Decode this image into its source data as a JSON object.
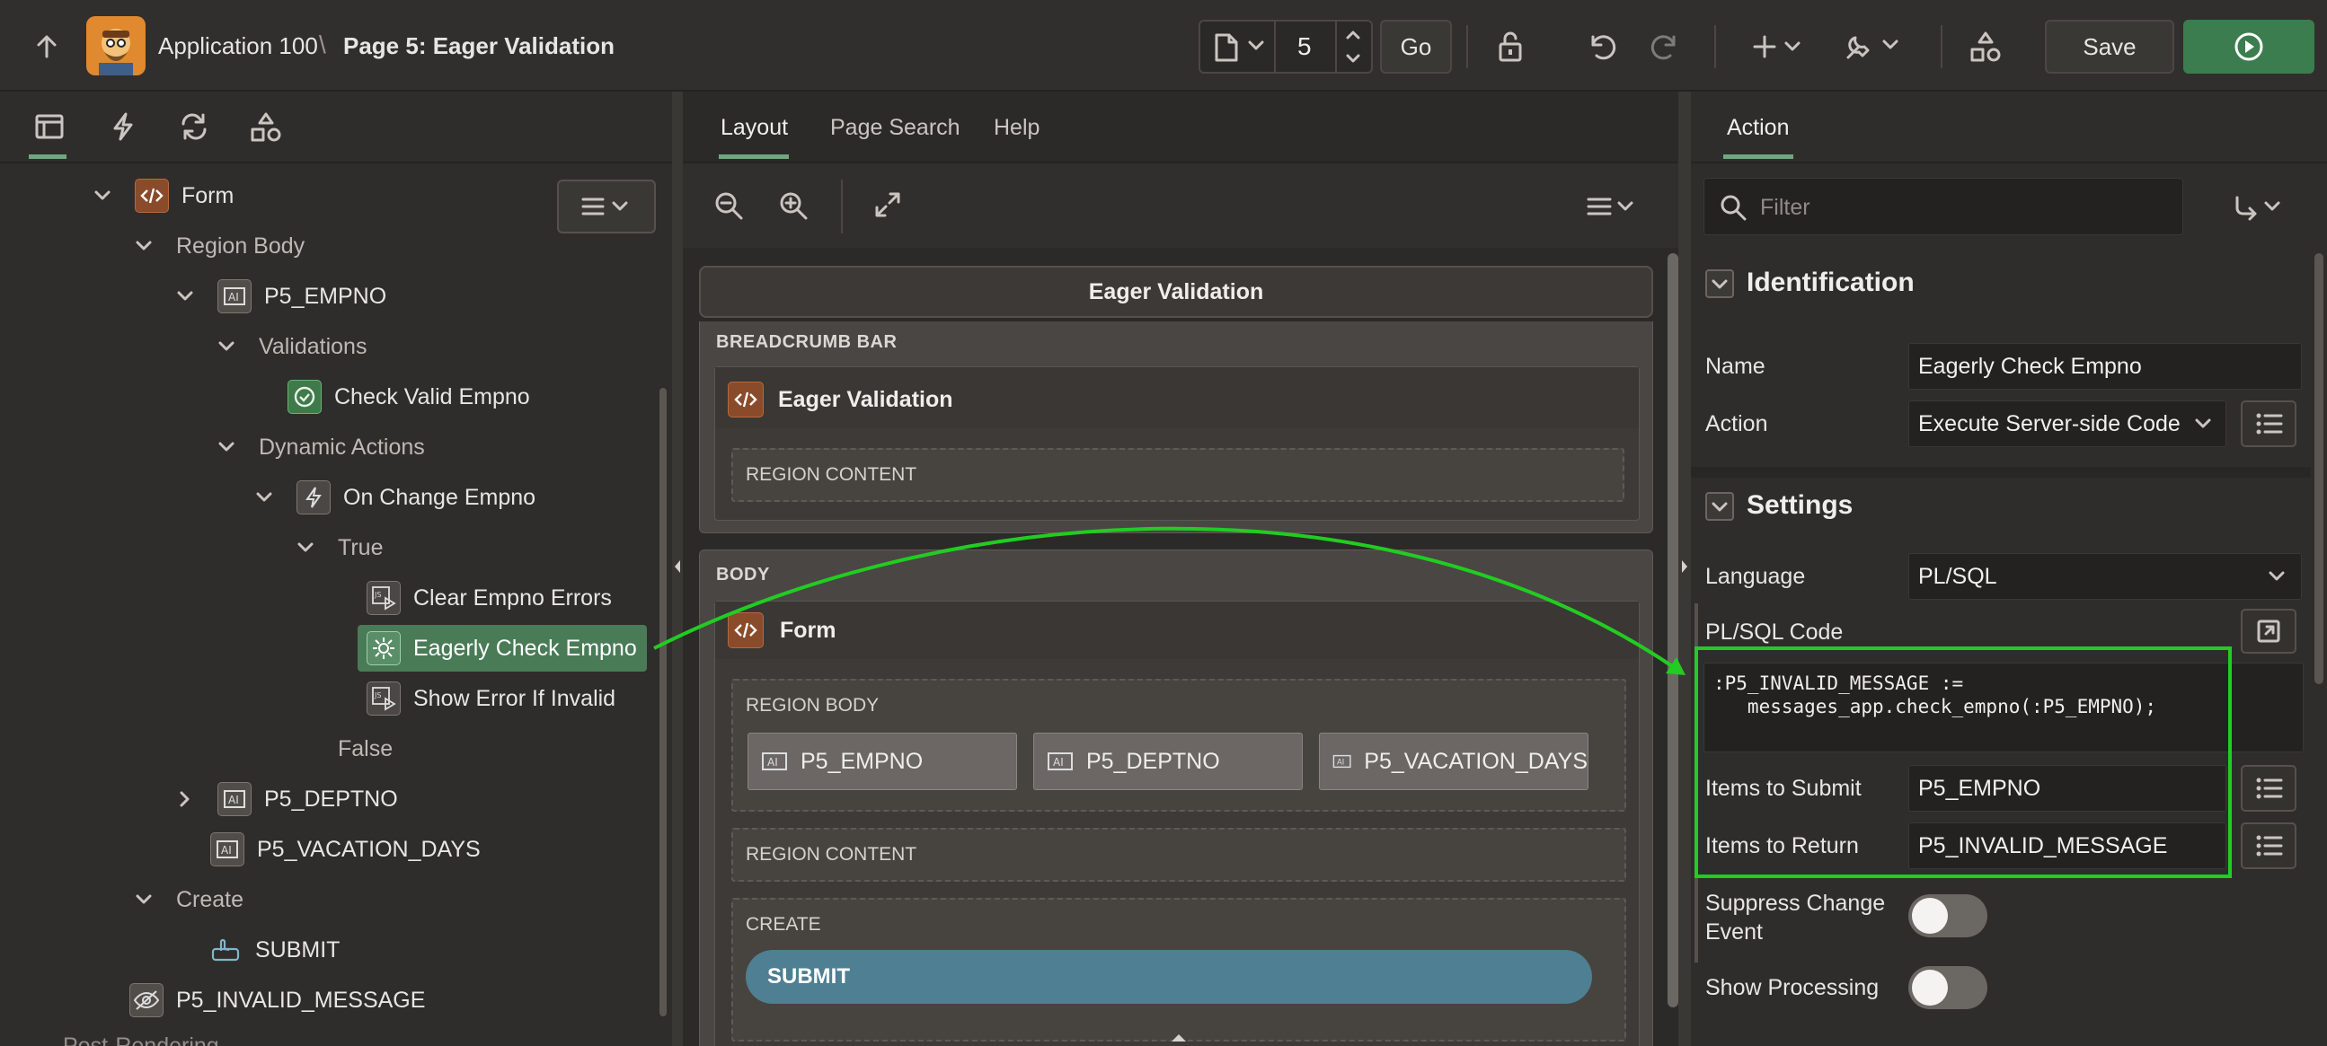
{
  "topbar": {
    "app_name": "Application 100",
    "separator": "\\",
    "page_title": "Page 5: Eager Validation",
    "page_number": "5",
    "go_label": "Go",
    "save_label": "Save"
  },
  "left_tabs": [
    "rendering-icon",
    "dynamic-actions-icon",
    "processing-icon",
    "shared-components-icon"
  ],
  "tree": {
    "form": "Form",
    "region_body": "Region Body",
    "p5_empno": "P5_EMPNO",
    "validations": "Validations",
    "check_valid_empno": "Check Valid Empno",
    "dynamic_actions": "Dynamic Actions",
    "on_change_empno": "On Change Empno",
    "true": "True",
    "clear_empno_errors": "Clear Empno Errors",
    "eagerly_check_empno": "Eagerly Check Empno",
    "show_error_if_invalid": "Show Error If Invalid",
    "false": "False",
    "p5_deptno": "P5_DEPTNO",
    "p5_vacation_days": "P5_VACATION_DAYS",
    "create": "Create",
    "submit": "SUBMIT",
    "p5_invalid_message": "P5_INVALID_MESSAGE",
    "post_rendering": "Post-Rendering"
  },
  "middle": {
    "tabs": [
      "Layout",
      "Page Search",
      "Help"
    ],
    "page_header": "Eager Validation",
    "breadcrumb_bar": "BREADCRUMB BAR",
    "breadcrumb_region": "Eager Validation",
    "region_content": "REGION CONTENT",
    "body": "BODY",
    "form_region": "Form",
    "region_body": "REGION BODY",
    "items": [
      "P5_EMPNO",
      "P5_DEPTNO",
      "P5_VACATION_DAYS"
    ],
    "region_content_2": "REGION CONTENT",
    "create": "CREATE",
    "submit": "SUBMIT"
  },
  "right": {
    "tab": "Action",
    "filter_placeholder": "Filter",
    "identification": "Identification",
    "name_label": "Name",
    "name_value": "Eagerly Check Empno",
    "action_label": "Action",
    "action_value": "Execute Server-side Code",
    "settings": "Settings",
    "language_label": "Language",
    "language_value": "PL/SQL",
    "plsql_label": "PL/SQL Code",
    "code_line1": ":P5_INVALID_MESSAGE :=",
    "code_line2": "   messages_app.check_empno(:P5_EMPNO);",
    "items_submit_label": "Items to Submit",
    "items_submit_value": "P5_EMPNO",
    "items_return_label": "Items to Return",
    "items_return_value": "P5_INVALID_MESSAGE",
    "suppress_label_1": "Suppress Change",
    "suppress_label_2": "Event",
    "show_processing_label": "Show Processing"
  },
  "colors": {
    "annotation": "#22cc22",
    "run_button": "#3b7d4f",
    "selected_node": "#4a7b57",
    "submit_button": "#4e7f93"
  }
}
